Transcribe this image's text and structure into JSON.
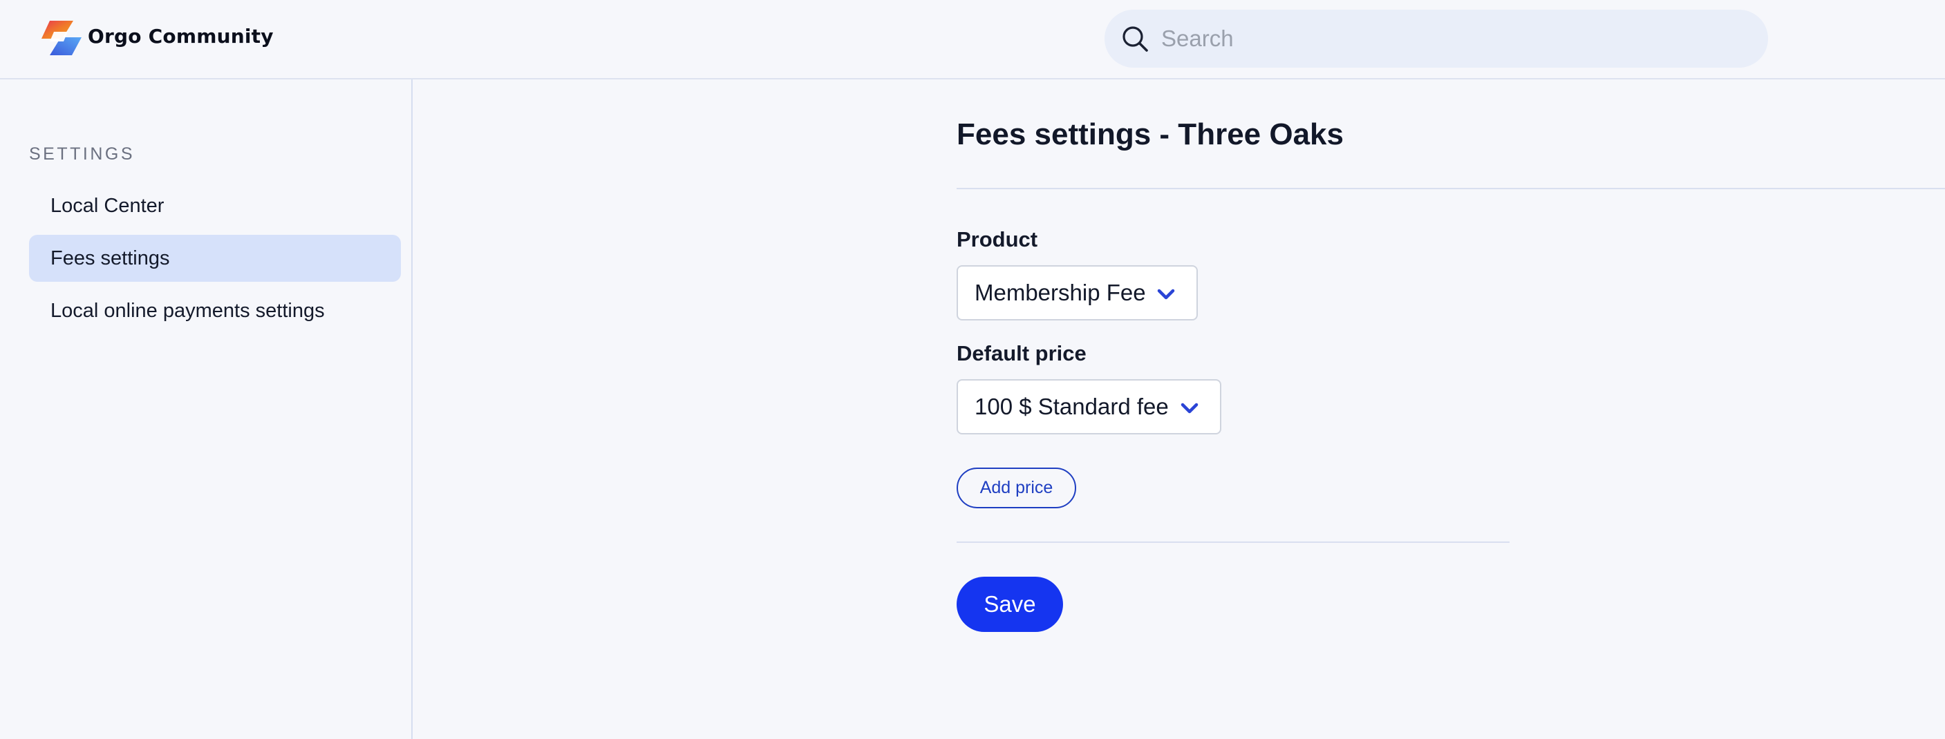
{
  "header": {
    "app_title": "Orgo Community",
    "logo_icon": "orgo-logo-icon",
    "search": {
      "placeholder": "Search",
      "value": "",
      "icon": "search-icon"
    }
  },
  "sidebar": {
    "heading": "SETTINGS",
    "items": [
      {
        "label": "Local Center",
        "active": false
      },
      {
        "label": "Fees settings",
        "active": true
      },
      {
        "label": "Local online payments settings",
        "active": false
      }
    ]
  },
  "main": {
    "title": "Fees settings - Three Oaks",
    "product": {
      "label": "Product",
      "selected": "Membership Fee"
    },
    "default_price": {
      "label": "Default price",
      "selected": "100 $ Standard fee"
    },
    "add_price_label": "Add price",
    "save_label": "Save"
  },
  "colors": {
    "accent": "#1535f0",
    "active_nav_bg": "#d6e1fa",
    "chevron": "#2a44d6",
    "page_bg": "#f6f7fb"
  }
}
